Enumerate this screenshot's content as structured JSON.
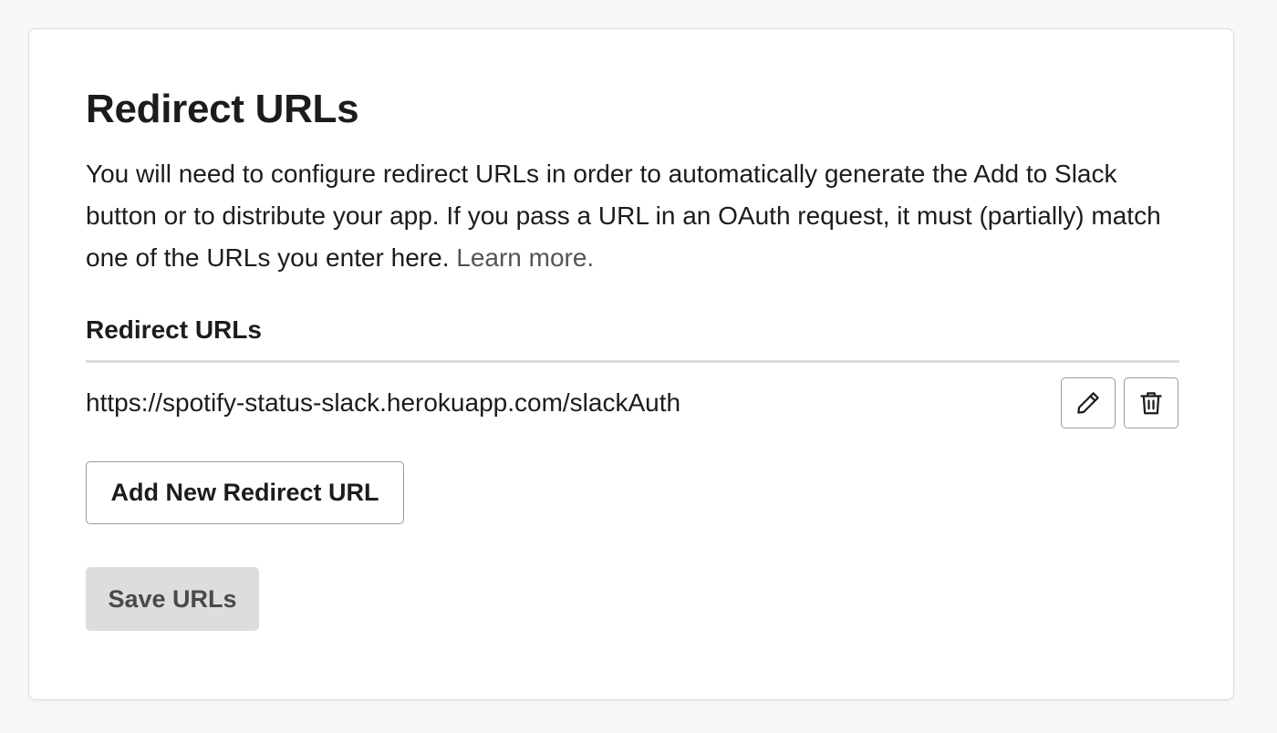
{
  "section": {
    "title": "Redirect URLs",
    "description_text": "You will need to configure redirect URLs in order to automatically generate the Add to Slack button or to distribute your app. If you pass a URL in an OAuth request, it must (partially) match one of the URLs you enter here. ",
    "learn_more_label": "Learn more."
  },
  "list": {
    "label": "Redirect URLs",
    "items": [
      {
        "url": "https://spotify-status-slack.herokuapp.com/slackAuth",
        "edit_icon": "pencil-icon",
        "delete_icon": "trash-icon"
      }
    ]
  },
  "actions": {
    "add_label": "Add New Redirect URL",
    "save_label": "Save URLs",
    "save_disabled": true
  },
  "colors": {
    "link": "#555555",
    "save_button_bg": "#dddddd",
    "divider": "#dddddd"
  }
}
